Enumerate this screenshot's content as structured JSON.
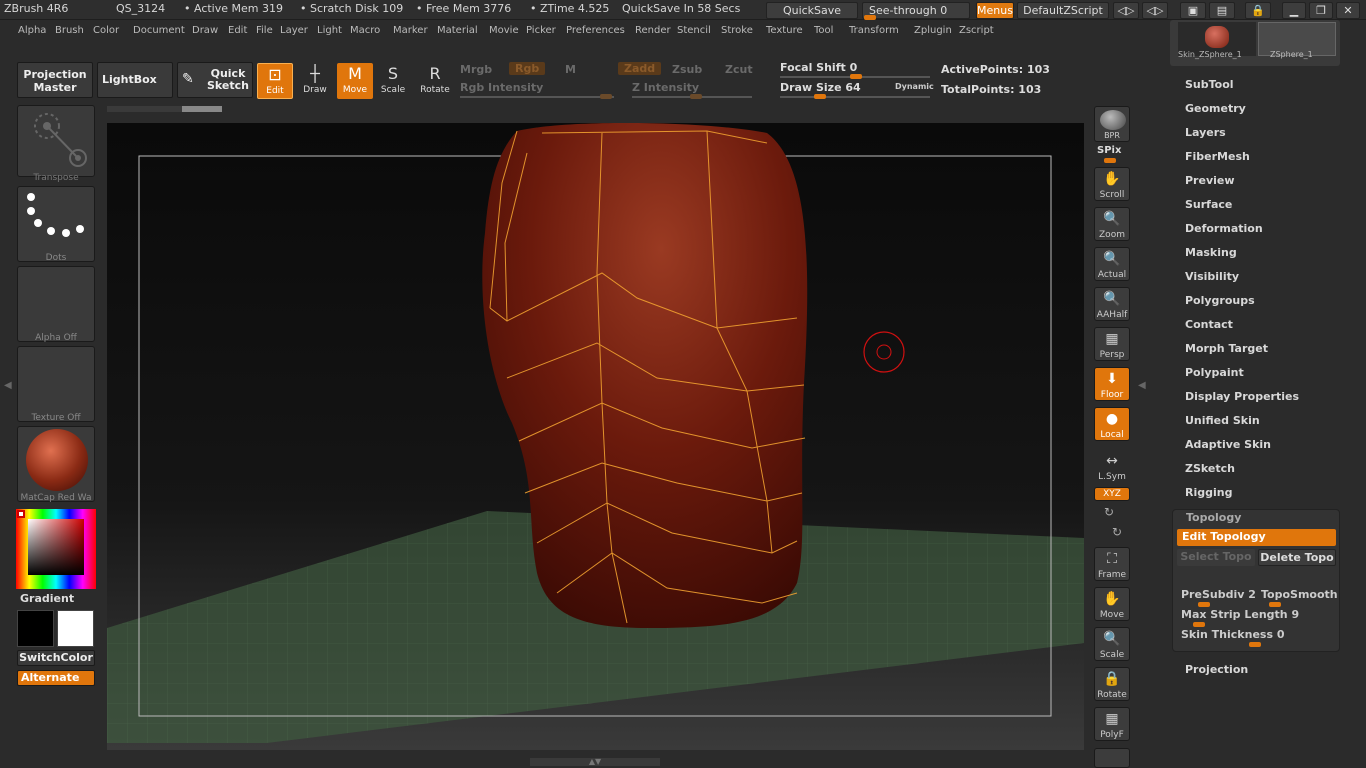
{
  "titlebar": {
    "app": "ZBrush 4R6",
    "qs": "QS_3124",
    "active_mem": "• Active Mem 319",
    "scratch": "• Scratch Disk 109",
    "free_mem": "• Free Mem 3776",
    "ztime": "• ZTime 4.525",
    "quicksave_in": "QuickSave In 58 Secs",
    "quicksave_btn": "QuickSave",
    "seethrough": "See-through  0",
    "menus_btn": "Menus",
    "default_zscript": "DefaultZScript"
  },
  "menubar": [
    "Alpha",
    "Brush",
    "Color",
    "Document",
    "Draw",
    "Edit",
    "File",
    "Layer",
    "Light",
    "Macro",
    "Marker",
    "Material",
    "Movie",
    "Picker",
    "Preferences",
    "Render",
    "Stencil",
    "Stroke",
    "Texture",
    "Tool",
    "Transform",
    "Zplugin",
    "Zscript"
  ],
  "toolbar": {
    "projection_master": "Projection Master",
    "lightbox": "LightBox",
    "quick_sketch": "Quick Sketch",
    "edit": "Edit",
    "draw": "Draw",
    "move": "Move",
    "scale": "Scale",
    "rotate": "Rotate",
    "mrgb": "Mrgb",
    "rgb": "Rgb",
    "m": "M",
    "zadd": "Zadd",
    "zsub": "Zsub",
    "zcut": "Zcut",
    "rgb_intensity": "Rgb Intensity",
    "z_intensity": "Z Intensity",
    "focal_shift": "Focal Shift 0",
    "draw_size": "Draw Size 64",
    "dynamic": "Dynamic",
    "active_points": "ActivePoints: 103",
    "total_points": "TotalPoints: 103"
  },
  "left": {
    "transpose": "Transpose",
    "dots": "Dots",
    "alpha": "Alpha Off",
    "texture": "Texture Off",
    "material": "MatCap Red Wa",
    "gradient": "Gradient",
    "switchcolor": "SwitchColor",
    "alternate": "Alternate"
  },
  "rightshelf": {
    "bpr": "BPR",
    "spix": "SPix",
    "scroll": "Scroll",
    "zoom": "Zoom",
    "actual": "Actual",
    "aahalf": "AAHalf",
    "persp": "Persp",
    "floor": "Floor",
    "local": "Local",
    "lsym": "L.Sym",
    "xyz": "XYZ",
    "frame": "Frame",
    "move": "Move",
    "scale": "Scale",
    "rotate": "Rotate",
    "polyf": "PolyF"
  },
  "tool_palette": {
    "thumb1": "Skin_ZSphere_1",
    "thumb2": "ZSphere_1",
    "items": [
      "SubTool",
      "Geometry",
      "Layers",
      "FiberMesh",
      "Preview",
      "Surface",
      "Deformation",
      "Masking",
      "Visibility",
      "Polygroups",
      "Contact",
      "Morph Target",
      "Polypaint",
      "Display Properties",
      "Unified Skin",
      "Adaptive Skin",
      "ZSketch",
      "Rigging"
    ],
    "topology": {
      "header": "Topology",
      "edit_topology": "Edit Topology",
      "select_topo": "Select Topo",
      "delete_topo": "Delete Topo",
      "presubdiv": "PreSubdiv 2",
      "toposmooth": "TopoSmooth",
      "max_strip": "Max Strip Length 9",
      "skin_thickness": "Skin Thickness 0"
    },
    "projection": "Projection"
  },
  "colors": {
    "accent": "#e0760c",
    "mesh": "#6b1a0c",
    "wire": "#f0a030",
    "floor": "#3e5a3e"
  }
}
